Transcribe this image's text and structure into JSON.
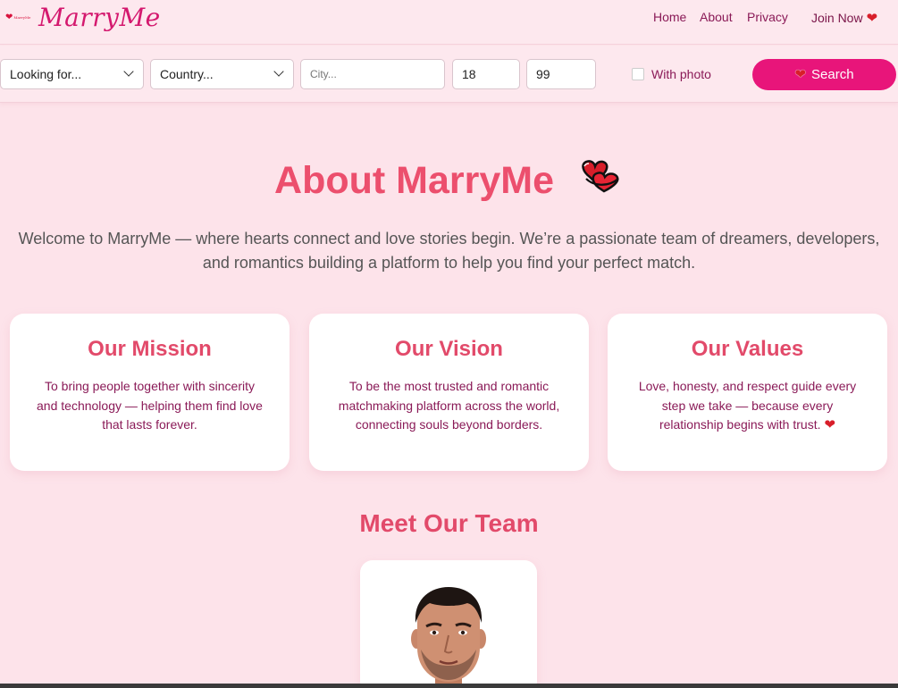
{
  "header": {
    "logo_mini_text": "MarryMe",
    "brand": "MarryMe",
    "nav": {
      "home": "Home",
      "about": "About",
      "privacy": "Privacy",
      "join": "Join Now"
    }
  },
  "search": {
    "looking_for": "Looking for...",
    "country": "Country...",
    "city_placeholder": "City...",
    "age_min": "18",
    "age_max": "99",
    "with_photo_label": "With photo",
    "with_photo_checked": false,
    "button_label": "Search"
  },
  "hero": {
    "title": "About MarryMe",
    "intro": "Welcome to MarryMe — where hearts connect and love stories begin. We’re a passionate team of dreamers, developers, and romantics building a platform to help you find your perfect match."
  },
  "cards": [
    {
      "title": "Our Mission",
      "text": "To bring people together with sincerity and technology — helping them find love that lasts forever."
    },
    {
      "title": "Our Vision",
      "text": "To be the most trusted and romantic matchmaking platform across the world, connecting souls beyond borders."
    },
    {
      "title": "Our Values",
      "text": "Love, honesty, and respect guide every step we take — because every relationship begins with trust."
    }
  ],
  "team": {
    "title": "Meet Our Team"
  },
  "colors": {
    "background": "#fde3ea",
    "accent": "#e8157a",
    "heading": "#ec4f6d",
    "heart": "#d81e2a"
  }
}
